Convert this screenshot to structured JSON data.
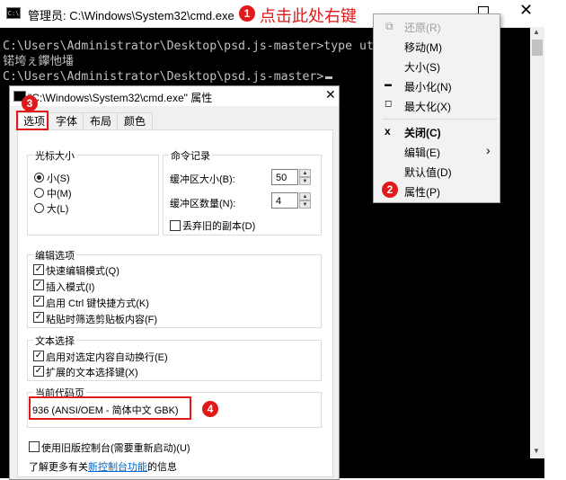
{
  "cmd": {
    "title": "管理员: C:\\Windows\\System32\\cmd.exe",
    "icon_text": "C:\\",
    "console_lines": [
      "C:\\Users\\Administrator\\Desktop\\psd.js-master>type ut",
      "锘垮ぇ鑻忚墦",
      "C:\\Users\\Administrator\\Desktop\\psd.js-master>"
    ]
  },
  "annotations": {
    "one": "1",
    "one_text": "点击此处右键",
    "two": "2",
    "three": "3",
    "four": "4"
  },
  "context_menu": {
    "items": [
      {
        "label": "还原(R)",
        "icon": "restore-icon",
        "glyph": "⧉",
        "disabled": true
      },
      {
        "label": "移动(M)"
      },
      {
        "label": "大小(S)"
      },
      {
        "label": "最小化(N)",
        "icon": "minimize-icon",
        "glyph": "▬"
      },
      {
        "label": "最大化(X)",
        "icon": "maximize-icon",
        "glyph": "◻"
      },
      {
        "label": "关闭(C)",
        "icon": "close-icon",
        "glyph": "x",
        "bold": true
      },
      {
        "label": "编辑(E)",
        "submenu": true,
        "chevron": "›"
      },
      {
        "label": "默认值(D)"
      },
      {
        "label": "属性(P)"
      }
    ]
  },
  "props": {
    "title": "\"C:\\Windows\\System32\\cmd.exe\" 属性",
    "tabs": [
      "选项",
      "字体",
      "布局",
      "颜色"
    ],
    "cursor_size": {
      "label": "光标大小",
      "options": [
        "小(S)",
        "中(M)",
        "大(L)"
      ],
      "selected": 0
    },
    "history": {
      "label": "命令记录",
      "buffer_size_label": "缓冲区大小(B):",
      "buffer_size_value": "50",
      "buffer_count_label": "缓冲区数量(N):",
      "buffer_count_value": "4",
      "discard_label": "丢弃旧的副本(D)"
    },
    "edit_options": {
      "label": "编辑选项",
      "items": [
        "快速编辑模式(Q)",
        "插入模式(I)",
        "启用 Ctrl 键快捷方式(K)",
        "粘贴时筛选剪贴板内容(F)"
      ]
    },
    "text_selection": {
      "label": "文本选择",
      "items": [
        "启用对选定内容自动换行(E)",
        "扩展的文本选择键(X)"
      ]
    },
    "codepage": {
      "label": "当前代码页",
      "value": "936   (ANSI/OEM - 简体中文 GBK)"
    },
    "legacy_label": "使用旧版控制台(需要重新启动)(U)",
    "learn_more_prefix": "了解更多有关",
    "learn_more_link": "新控制台功能",
    "learn_more_suffix": "的信息"
  }
}
